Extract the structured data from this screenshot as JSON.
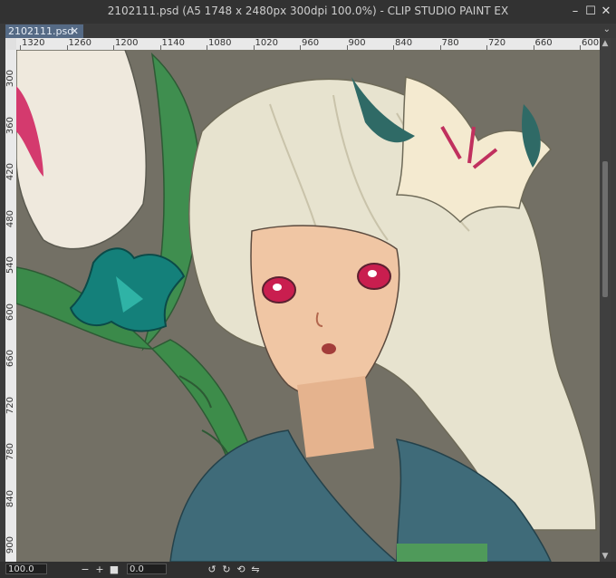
{
  "window": {
    "title": "2102111.psd (A5 1748 x 2480px 300dpi 100.0%) - CLIP STUDIO PAINT EX"
  },
  "tabs": [
    {
      "label": "2102111.psd",
      "close": "✕"
    }
  ],
  "rulers": {
    "horizontal": [
      "1320",
      "1260",
      "1200",
      "1140",
      "1080",
      "1020",
      "960",
      "900",
      "840",
      "780",
      "720",
      "660",
      "600"
    ],
    "vertical": [
      "300",
      "360",
      "420",
      "480",
      "540",
      "600",
      "660",
      "720",
      "780",
      "840",
      "900"
    ]
  },
  "status": {
    "zoom": "100.0",
    "rotation": "0.0"
  },
  "colors": {
    "canvas_bg": "#737065",
    "accent_tab": "#556a85"
  }
}
